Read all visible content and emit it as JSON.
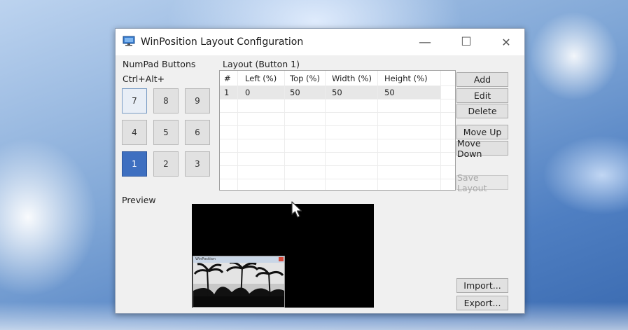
{
  "window": {
    "title": "WinPosition Layout Configuration",
    "minimize": "—",
    "maximize": "☐",
    "close": "✕"
  },
  "numpad": {
    "group_label": "NumPad Buttons",
    "modifier": "Ctrl+Alt+",
    "keys": [
      "7",
      "8",
      "9",
      "4",
      "5",
      "6",
      "1",
      "2",
      "3"
    ],
    "active_key": "1"
  },
  "layout": {
    "label": "Layout (Button 1)",
    "columns": [
      "#",
      "Left (%)",
      "Top (%)",
      "Width (%)",
      "Height (%)"
    ],
    "rows": [
      [
        "1",
        "0",
        "50",
        "50",
        "50"
      ]
    ]
  },
  "buttons": {
    "add": "Add",
    "edit": "Edit",
    "delete": "Delete",
    "move_up": "Move Up",
    "move_down": "Move Down",
    "save_layout": "Save Layout",
    "import": "Import...",
    "export": "Export..."
  },
  "preview": {
    "label": "Preview",
    "mini_window_title": "WinPosition"
  },
  "icons": {
    "app": "monitor-icon",
    "cursor": "mouse-pointer-icon"
  },
  "colors": {
    "active_key": "#3e6fc0",
    "window_bg": "#f0f0f0",
    "preview_bg": "#000000"
  }
}
